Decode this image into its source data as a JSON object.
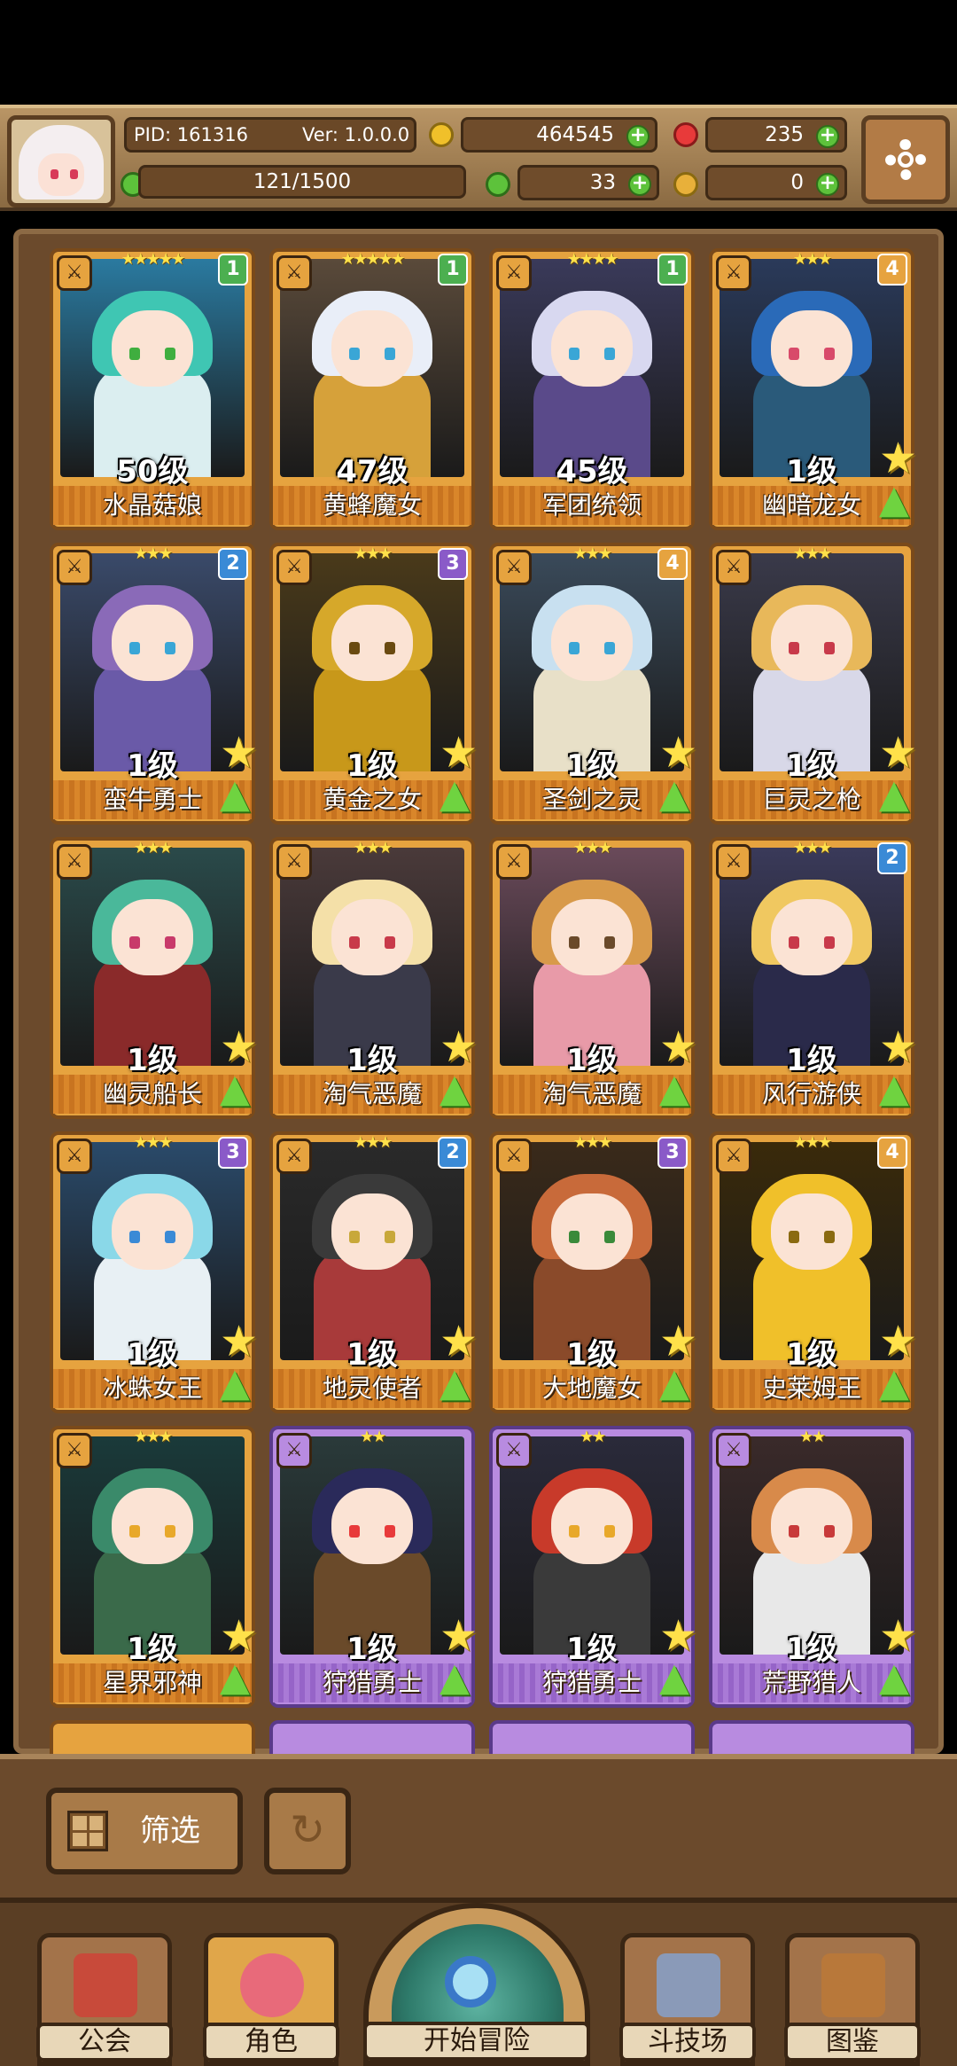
{
  "header": {
    "pid": "PID: 161316",
    "version": "Ver: 1.0.0.0",
    "gold": "464545",
    "gems": "235",
    "energy": "121/1500",
    "clover": "33",
    "bread": "0"
  },
  "cards": [
    {
      "name": "水晶菇娘",
      "level": "50级",
      "stars": "★★★★★",
      "rank": "1",
      "rank_color": "#4caf50",
      "hair": "#3fc6b3",
      "bg": "#2a7aa0",
      "body": "#dbeef0",
      "eye": "#3fae3f",
      "frame": "gold",
      "show_up": false
    },
    {
      "name": "黄蜂魔女",
      "level": "47级",
      "stars": "★★★★★",
      "rank": "1",
      "rank_color": "#4caf50",
      "hair": "#e9eef8",
      "bg": "#5a4a3a",
      "body": "#d6a13a",
      "eye": "#3aa6d6",
      "frame": "gold",
      "show_up": false
    },
    {
      "name": "军团统领",
      "level": "45级",
      "stars": "★★★★",
      "rank": "1",
      "rank_color": "#4caf50",
      "hair": "#d8d8f0",
      "bg": "#3a3a5a",
      "body": "#5a4a8a",
      "eye": "#3aa6d6",
      "frame": "gold",
      "show_up": false
    },
    {
      "name": "幽暗龙女",
      "level": "1级",
      "stars": "★★★",
      "rank": "4",
      "rank_color": "#e6a33f",
      "hair": "#2a6ab8",
      "bg": "#2a3a5a",
      "body": "#2a5a7a",
      "eye": "#d84a6a",
      "frame": "gold",
      "show_up": true
    },
    {
      "name": "蛮牛勇士",
      "level": "1级",
      "stars": "★★★",
      "rank": "2",
      "rank_color": "#3a8ad6",
      "hair": "#8a6ab8",
      "bg": "#3a4a6a",
      "body": "#6a5aa8",
      "eye": "#3aa6d6",
      "frame": "gold",
      "show_up": true
    },
    {
      "name": "黄金之女",
      "level": "1级",
      "stars": "★★★",
      "rank": "3",
      "rank_color": "#8a5ac8",
      "hair": "#d6a82a",
      "bg": "#4a3a1a",
      "body": "#c8981a",
      "eye": "#6a4a10",
      "frame": "gold",
      "show_up": true
    },
    {
      "name": "圣剑之灵",
      "level": "1级",
      "stars": "★★★",
      "rank": "4",
      "rank_color": "#e6a33f",
      "hair": "#c8e0f0",
      "bg": "#3a4a5a",
      "body": "#e8e0c8",
      "eye": "#3aa6d6",
      "frame": "gold",
      "show_up": true
    },
    {
      "name": "巨灵之枪",
      "level": "1级",
      "stars": "★★★",
      "rank": "",
      "rank_color": "",
      "hair": "#e8b85a",
      "bg": "#3a3a4a",
      "body": "#d8d8e8",
      "eye": "#c83a4a",
      "frame": "gold",
      "show_up": true
    },
    {
      "name": "幽灵船长",
      "level": "1级",
      "stars": "★★★",
      "rank": "",
      "rank_color": "",
      "hair": "#4ab89a",
      "bg": "#2a4a4a",
      "body": "#8a2a2a",
      "eye": "#c83a6a",
      "frame": "gold",
      "show_up": true
    },
    {
      "name": "淘气恶魔",
      "level": "1级",
      "stars": "★★★",
      "rank": "",
      "rank_color": "",
      "hair": "#f4e0a8",
      "bg": "#4a3a3a",
      "body": "#3a3a4a",
      "eye": "#c83a4a",
      "frame": "gold",
      "show_up": true
    },
    {
      "name": "淘气恶魔",
      "level": "1级",
      "stars": "★★★",
      "rank": "",
      "rank_color": "",
      "hair": "#d89a4a",
      "bg": "#6a4a5a",
      "body": "#e89aa8",
      "eye": "#6a4a2a",
      "frame": "gold",
      "show_up": true
    },
    {
      "name": "风行游侠",
      "level": "1级",
      "stars": "★★★",
      "rank": "2",
      "rank_color": "#3a8ad6",
      "hair": "#f0c860",
      "bg": "#3a3a5a",
      "body": "#2a2a4a",
      "eye": "#c83a4a",
      "frame": "gold",
      "show_up": true
    },
    {
      "name": "冰蛛女王",
      "level": "1级",
      "stars": "★★★",
      "rank": "3",
      "rank_color": "#8a5ac8",
      "hair": "#8ad8e8",
      "bg": "#2a4a6a",
      "body": "#e8f0f4",
      "eye": "#3a8ad6",
      "frame": "gold",
      "show_up": true
    },
    {
      "name": "地灵使者",
      "level": "1级",
      "stars": "★★★",
      "rank": "2",
      "rank_color": "#3a8ad6",
      "hair": "#3a3a3a",
      "bg": "#2a2a2a",
      "body": "#a83a3a",
      "eye": "#c8a83a",
      "frame": "gold",
      "show_up": true
    },
    {
      "name": "大地魔女",
      "level": "1级",
      "stars": "★★★",
      "rank": "3",
      "rank_color": "#8a5ac8",
      "hair": "#c86a3a",
      "bg": "#3a2a1a",
      "body": "#8a4a2a",
      "eye": "#3a8a3a",
      "frame": "gold",
      "show_up": true
    },
    {
      "name": "史莱姆王",
      "level": "1级",
      "stars": "★★★",
      "rank": "4",
      "rank_color": "#e6a33f",
      "hair": "#f0c02a",
      "bg": "#3a2a0a",
      "body": "#f0c02a",
      "eye": "#8a6a10",
      "frame": "gold",
      "show_up": true
    },
    {
      "name": "星界邪神",
      "level": "1级",
      "stars": "★★★",
      "rank": "",
      "rank_color": "",
      "hair": "#3a8a6a",
      "bg": "#1a3a3a",
      "body": "#3a6a4a",
      "eye": "#e8a82a",
      "frame": "gold",
      "show_up": true
    },
    {
      "name": "狩猎勇士",
      "level": "1级",
      "stars": "★★",
      "rank": "",
      "rank_color": "",
      "hair": "#2a2a5a",
      "bg": "#2a3a3a",
      "body": "#6a4a2a",
      "eye": "#e83a3a",
      "frame": "purple",
      "show_up": true
    },
    {
      "name": "狩猎勇士",
      "level": "1级",
      "stars": "★★",
      "rank": "",
      "rank_color": "",
      "hair": "#c83a2a",
      "bg": "#2a2a3a",
      "body": "#3a3a3a",
      "eye": "#e8a82a",
      "frame": "purple",
      "show_up": true
    },
    {
      "name": "荒野猎人",
      "level": "1级",
      "stars": "★★",
      "rank": "",
      "rank_color": "",
      "hair": "#d88a4a",
      "bg": "#3a2a2a",
      "body": "#e8e8e8",
      "eye": "#c83a3a",
      "frame": "purple",
      "show_up": true
    }
  ],
  "filter": {
    "label": "筛选"
  },
  "nav": {
    "guild": "公会",
    "character": "角色",
    "adventure": "开始冒险",
    "arena": "斗技场",
    "codex": "图鉴"
  }
}
